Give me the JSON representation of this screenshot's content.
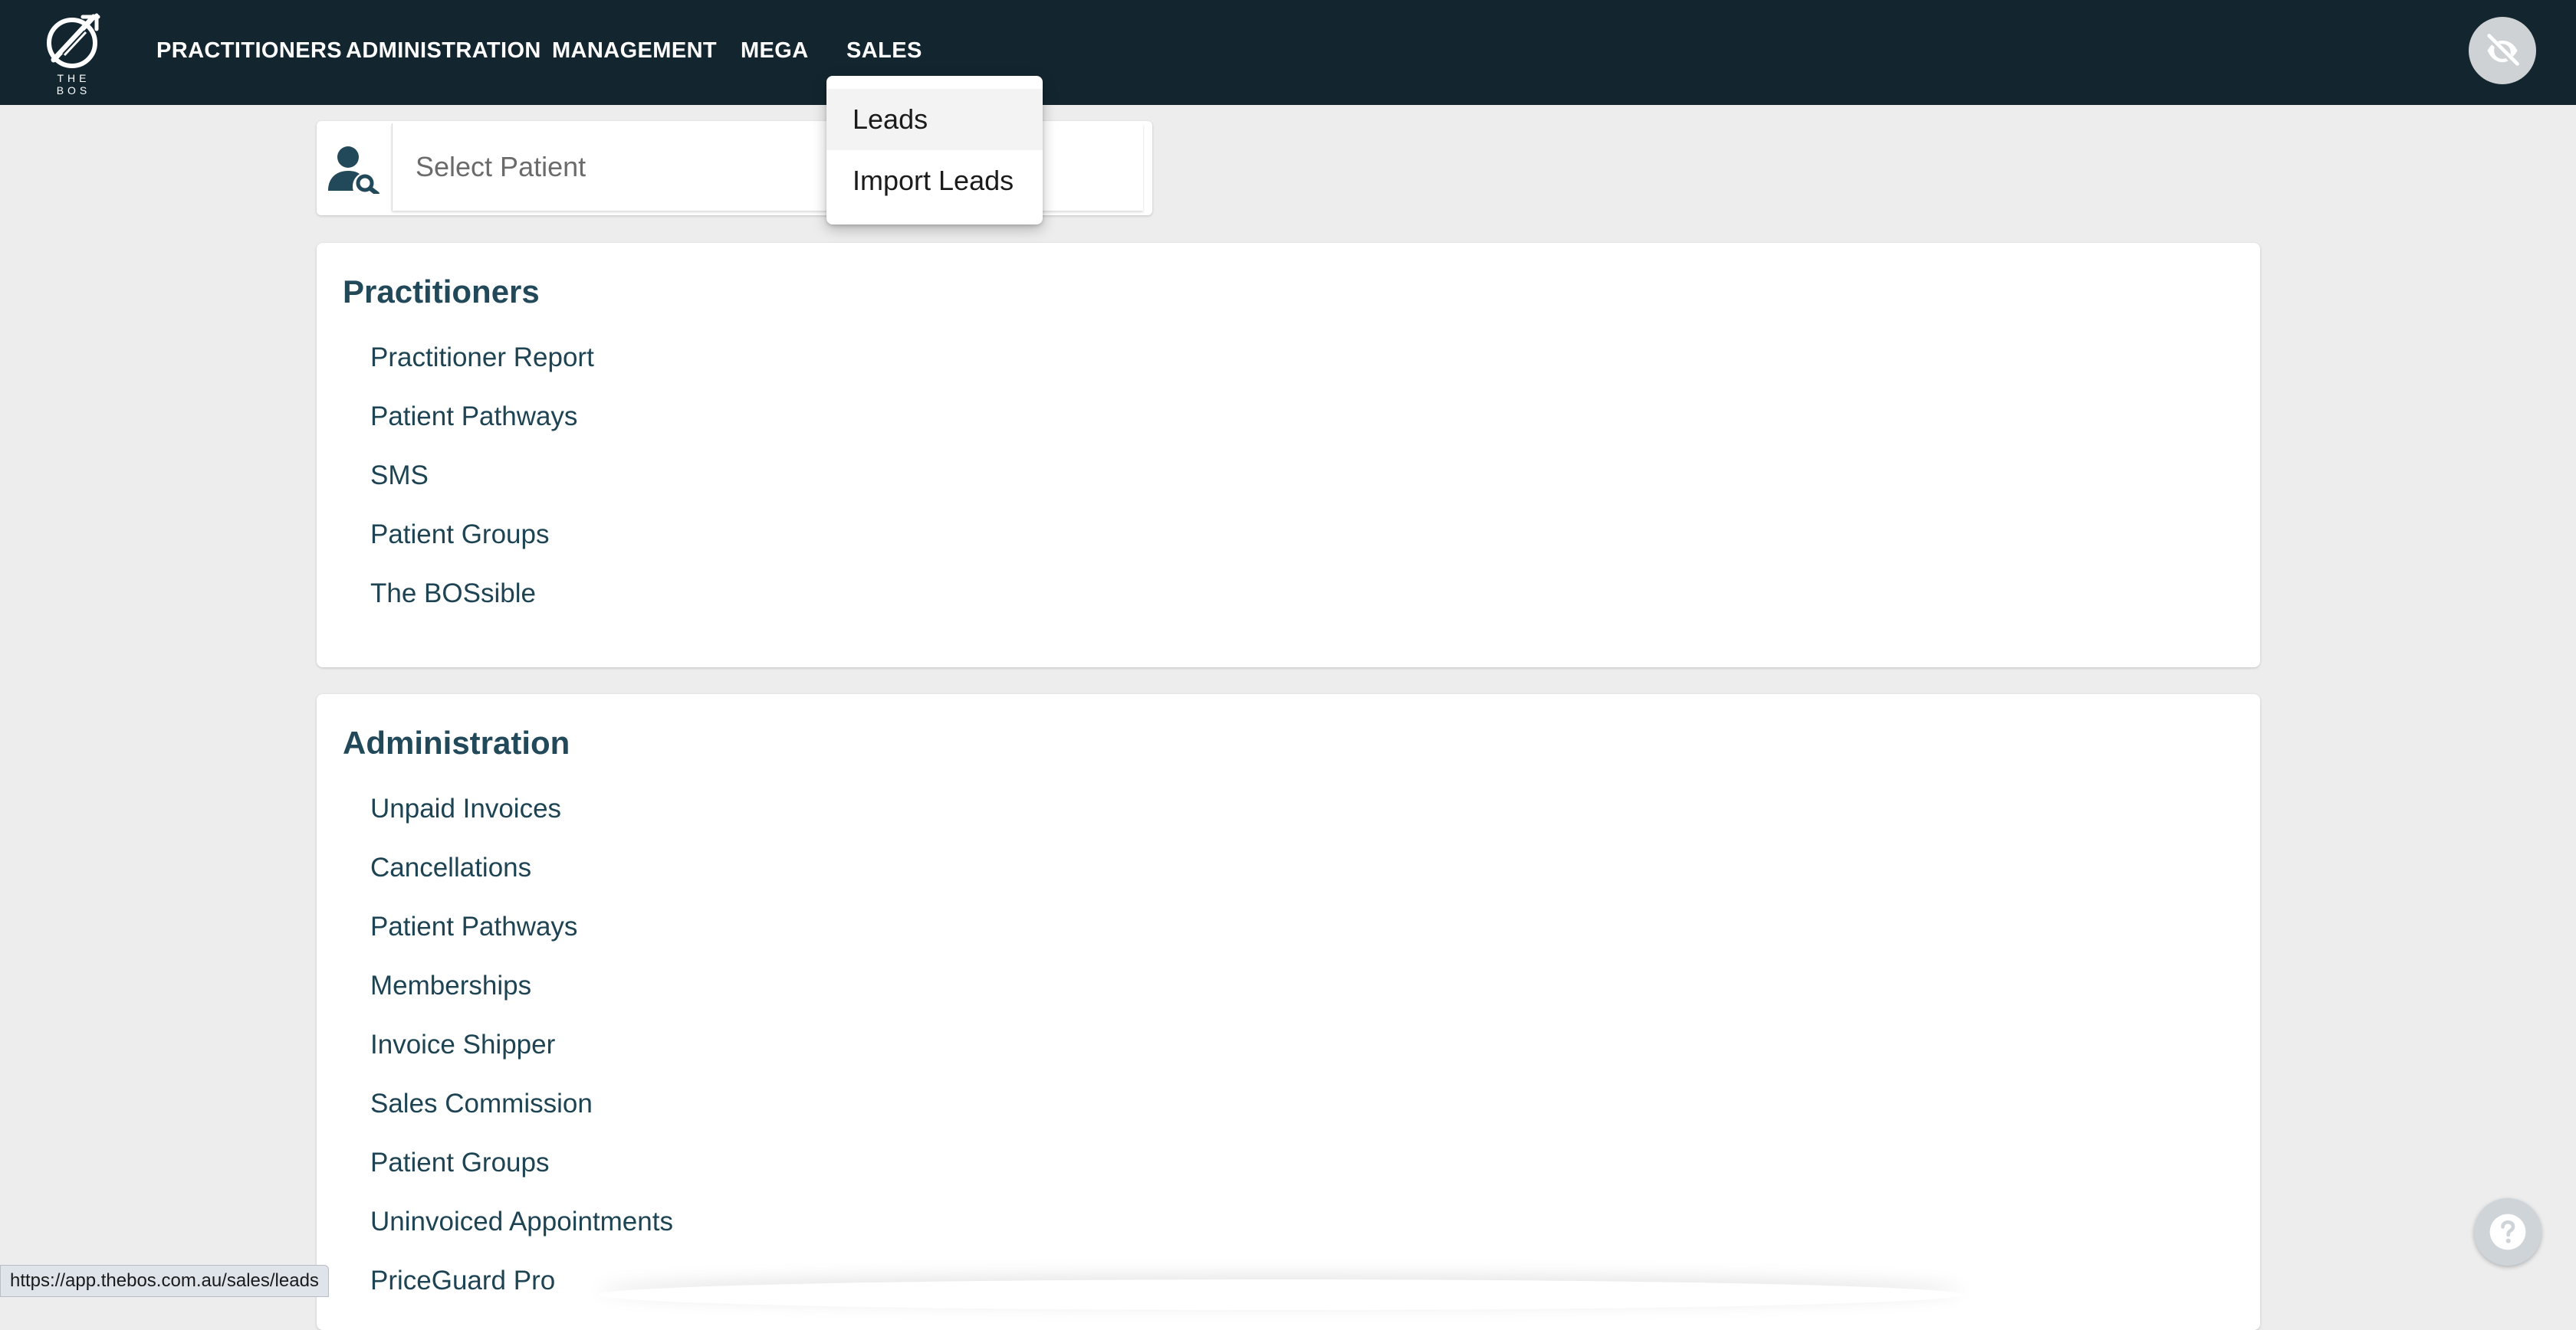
{
  "logo": {
    "text": "THE BOS"
  },
  "nav": {
    "items": [
      {
        "label": "PRACTITIONERS"
      },
      {
        "label": "ADMINISTRATION"
      },
      {
        "label": "MANAGEMENT"
      },
      {
        "label": "MEGA"
      },
      {
        "label": "SALES"
      }
    ]
  },
  "sales_menu": {
    "items": [
      {
        "label": "Leads",
        "hovered": true
      },
      {
        "label": "Import Leads"
      }
    ]
  },
  "patient_search": {
    "placeholder": "Select Patient"
  },
  "practitioners": {
    "title": "Practitioners",
    "links": [
      "Practitioner Report",
      "Patient Pathways",
      "SMS",
      "Patient Groups",
      "The BOSsible"
    ]
  },
  "administration": {
    "title": "Administration",
    "links": [
      "Unpaid Invoices",
      "Cancellations",
      "Patient Pathways",
      "Memberships",
      "Invoice Shipper",
      "Sales Commission",
      "Patient Groups",
      "Uninvoiced Appointments",
      "PriceGuard Pro"
    ]
  },
  "status_url": "https://app.thebos.com.au/sales/leads",
  "icons": {
    "logo": "bos-logo-icon",
    "privacy": "eye-off-icon",
    "patient": "person-search-icon",
    "help": "question-icon"
  },
  "colors": {
    "topbar": "#132630",
    "heading": "#22495a",
    "link": "#1e4454",
    "background": "#ededed"
  }
}
